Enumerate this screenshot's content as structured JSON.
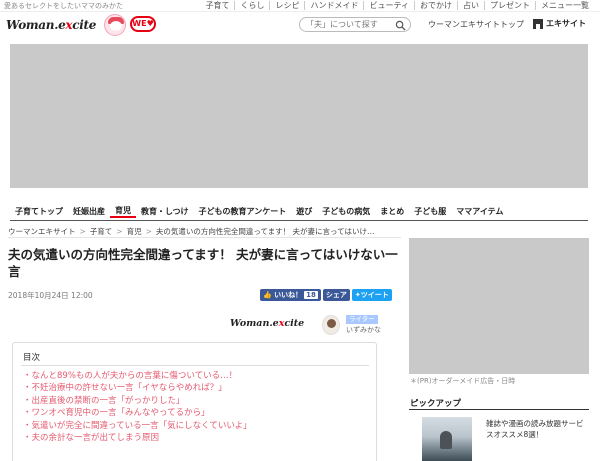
{
  "topbar": {
    "tagline": "愛あるセレクトをしたいママのみかた",
    "links": [
      "子育て",
      "くらし",
      "レシピ",
      "ハンドメイド",
      "ビューティ",
      "おでかけ",
      "占い",
      "プレゼント",
      "メニュー一覧"
    ]
  },
  "header": {
    "logo_left": "Woman.e",
    "logo_x": "x",
    "logo_right": "cite",
    "wego_label": "WE",
    "search_placeholder": "「夫」について探す",
    "woman_top_link": "ウーマンエキサイトトップ",
    "excite_link": "エキサイト"
  },
  "category_nav": {
    "items": [
      "子育てトップ",
      "妊娠出産",
      "育児",
      "教育・しつけ",
      "子どもの教育アンケート",
      "遊び",
      "子どもの病気",
      "まとめ",
      "子ども服",
      "ママアイテム"
    ],
    "active_index": 2
  },
  "breadcrumb": {
    "items": [
      "ウーマンエキサイト",
      "子育て",
      "育児",
      "夫の気遣いの方向性完全間違ってます！ 夫が妻に言ってはいけ…"
    ],
    "separator": ">"
  },
  "article": {
    "title": "夫の気遣いの方向性完全間違ってます！ 夫が妻に言ってはいけない一言",
    "date": "2018年10月24日 12:00",
    "like_label": "いいね！",
    "like_count": "18",
    "share_label": "シェア",
    "tweet_label": "ツイート",
    "writer_badge": "ライター",
    "writer_name": "いずみかな"
  },
  "toc": {
    "heading": "目次",
    "items": [
      "・なんと89%もの人が夫からの言葉に傷ついている…！",
      "・不妊治療中の許せない一言「イヤならやめれば？」",
      "・出産直後の禁断の一言「がっかりした」",
      "・ワンオペ育児中の一言「みんなやってるから」",
      "・気遣いが完全に間違っている一言「気にしなくていいよ」",
      "・夫の余計な一言が出てしまう原因"
    ]
  },
  "sidebar": {
    "pr_note": "＊(PR)オーダーメイド広告・日時",
    "pickup_heading": "ピックアップ",
    "pickup_text": "雑誌や漫画の読み放題サービスオススメ8選！"
  },
  "colors": {
    "accent": "#e60012",
    "toc_link": "#e55a6f",
    "facebook": "#3b5998",
    "twitter": "#1da1f2",
    "placeholder_gray": "#c9c9c9"
  }
}
